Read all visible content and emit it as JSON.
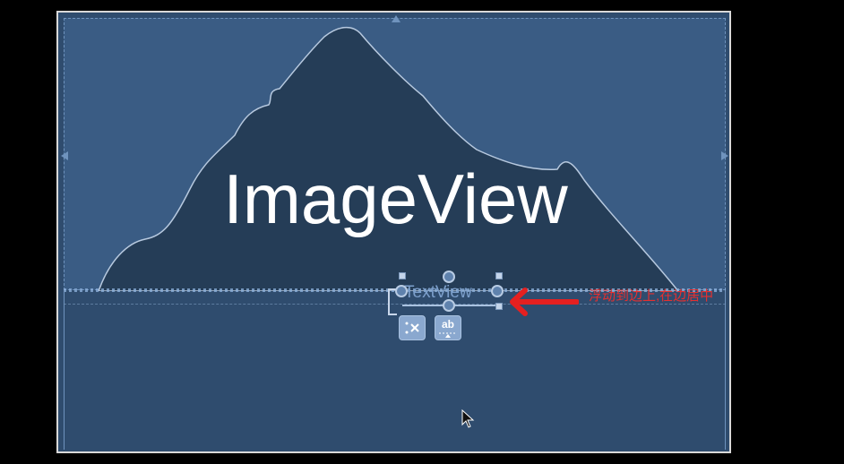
{
  "canvas": {
    "imageview": {
      "label": "ImageView"
    },
    "textview": {
      "label": "TextView"
    },
    "toolbar": {
      "clear_constraints_icon": "clear-constraints-icon",
      "baseline_label": "ab"
    }
  },
  "annotation": {
    "text": "浮动到边上,在边居中"
  },
  "colors": {
    "background": "#000000",
    "canvas": "#2f4c6e",
    "imageview": "#3a5c84",
    "mountain": "#253d57",
    "annotation": "#e53030"
  }
}
